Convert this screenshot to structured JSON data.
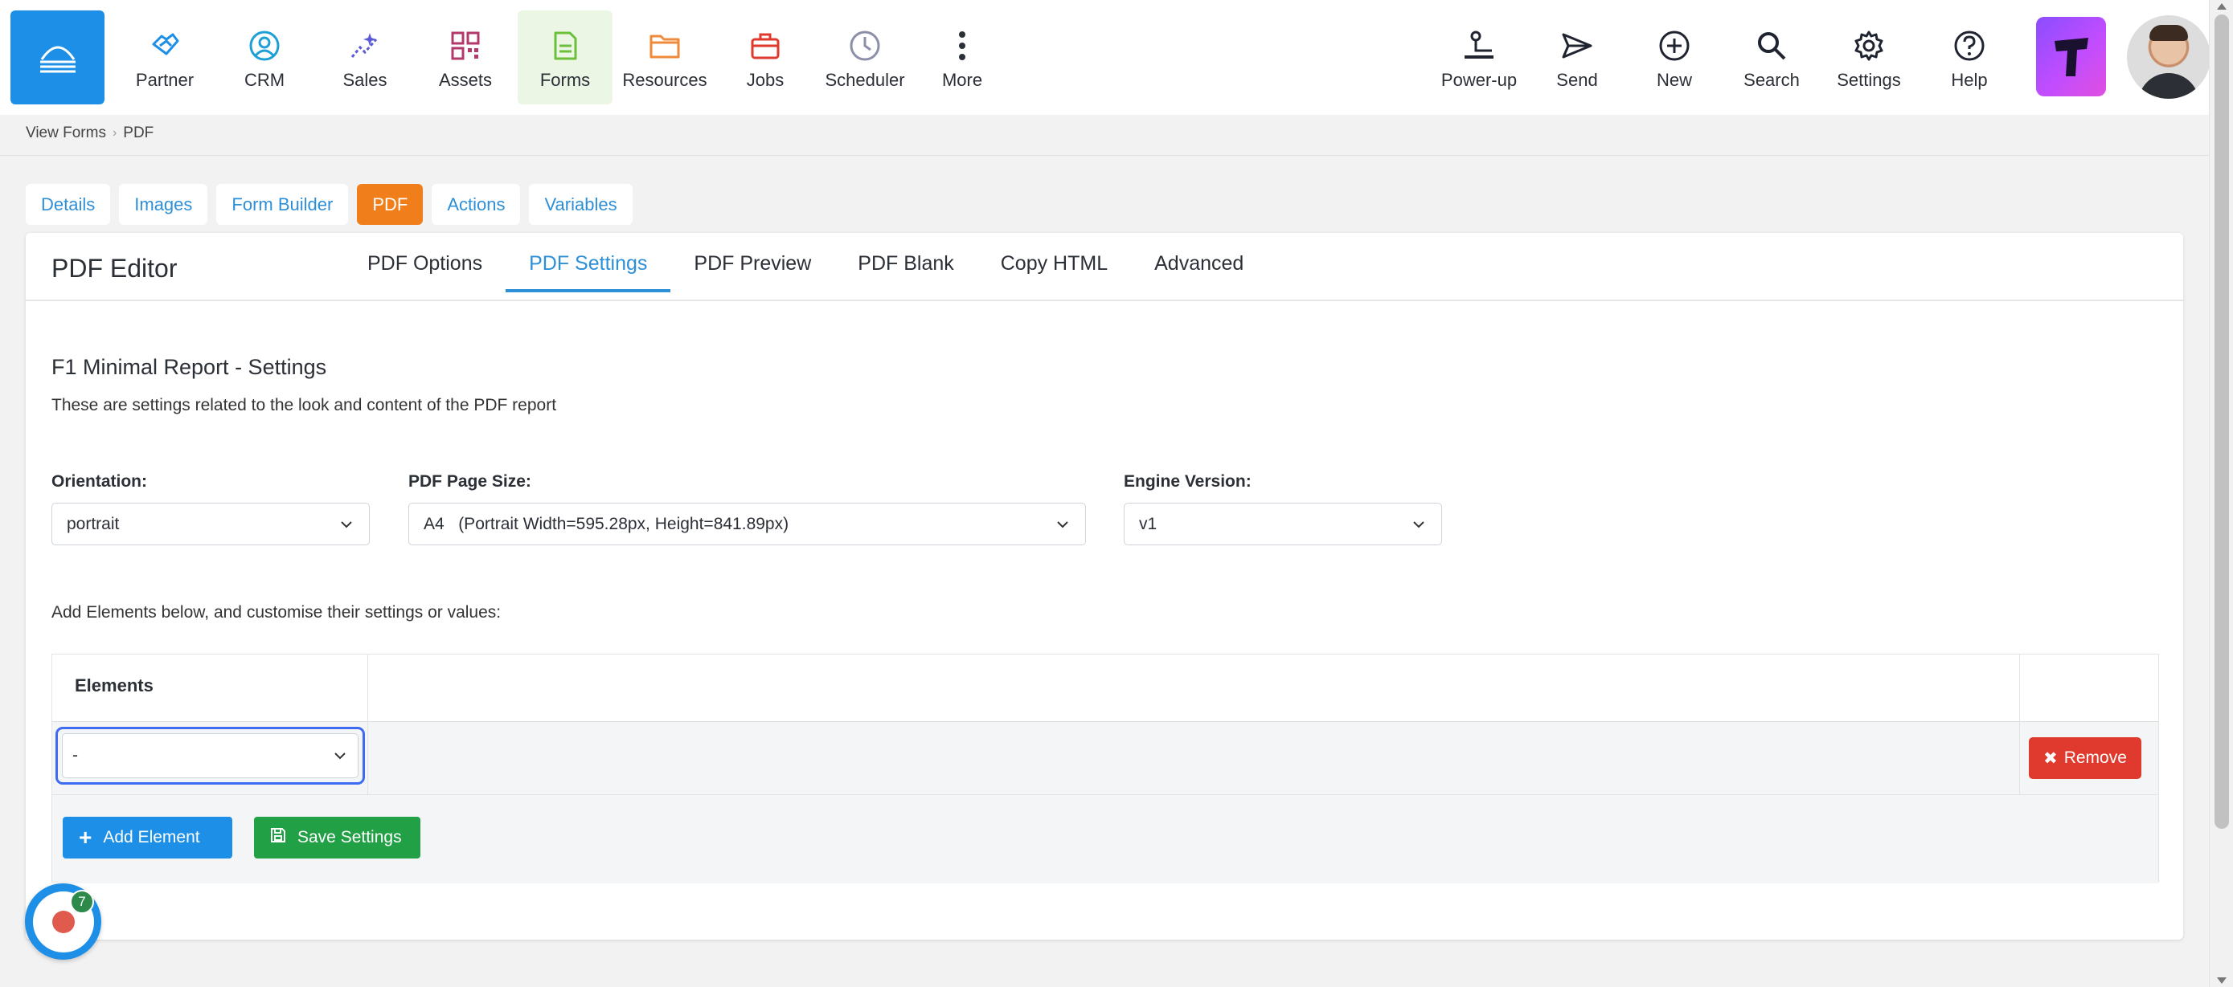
{
  "nav": {
    "items": [
      {
        "label": "Partner",
        "icon": "handshake-icon",
        "color": "#1e8fe6"
      },
      {
        "label": "CRM",
        "icon": "user-circle-icon",
        "color": "#1ea0d6"
      },
      {
        "label": "Sales",
        "icon": "sparkle-chart-icon",
        "color": "#5b5bd6"
      },
      {
        "label": "Assets",
        "icon": "qr-code-icon",
        "color": "#b3386b"
      },
      {
        "label": "Forms",
        "icon": "document-icon",
        "color": "#6cbf3a"
      },
      {
        "label": "Resources",
        "icon": "folder-icon",
        "color": "#ef8a3a"
      },
      {
        "label": "Jobs",
        "icon": "briefcase-icon",
        "color": "#e0392d"
      },
      {
        "label": "Scheduler",
        "icon": "clock-icon",
        "color": "#8c8fa8"
      },
      {
        "label": "More",
        "icon": "more-vertical-icon",
        "color": "#2b2f36"
      }
    ],
    "right_items": [
      {
        "label": "Power-up",
        "icon": "power-up-icon"
      },
      {
        "label": "Send",
        "icon": "send-icon"
      },
      {
        "label": "New",
        "icon": "plus-circle-icon"
      },
      {
        "label": "Search",
        "icon": "search-icon"
      },
      {
        "label": "Settings",
        "icon": "gear-icon"
      },
      {
        "label": "Help",
        "icon": "help-circle-icon"
      }
    ],
    "brand_tile_letter": "T"
  },
  "breadcrumb": {
    "items": [
      "View Forms",
      "PDF"
    ]
  },
  "form_tabs": [
    "Details",
    "Images",
    "Form Builder",
    "PDF",
    "Actions",
    "Variables"
  ],
  "form_tabs_active": "PDF",
  "editor": {
    "title": "PDF Editor",
    "subtabs": [
      "PDF Options",
      "PDF Settings",
      "PDF Preview",
      "PDF Blank",
      "Copy HTML",
      "Advanced"
    ],
    "active_subtab": "PDF Settings"
  },
  "settings": {
    "title": "F1 Minimal Report - Settings",
    "description": "These are settings related to the look and content of the PDF report",
    "orientation": {
      "label": "Orientation:",
      "value": "portrait"
    },
    "page_size": {
      "label": "PDF Page Size:",
      "value": "A4   (Portrait Width=595.28px, Height=841.89px)"
    },
    "engine": {
      "label": "Engine Version:",
      "value": "v1"
    },
    "add_hint": "Add Elements below, and customise their settings or values:"
  },
  "elements": {
    "header": "Elements",
    "row_value": "-",
    "remove_label": "Remove",
    "add_label": "Add Element",
    "save_label": "Save Settings"
  },
  "widget": {
    "badge": "7"
  },
  "colors": {
    "accent": "#1e8fe6",
    "active_tab": "#f07f1b",
    "remove": "#e0392d",
    "save": "#22a046",
    "link": "#2d8fd6"
  }
}
